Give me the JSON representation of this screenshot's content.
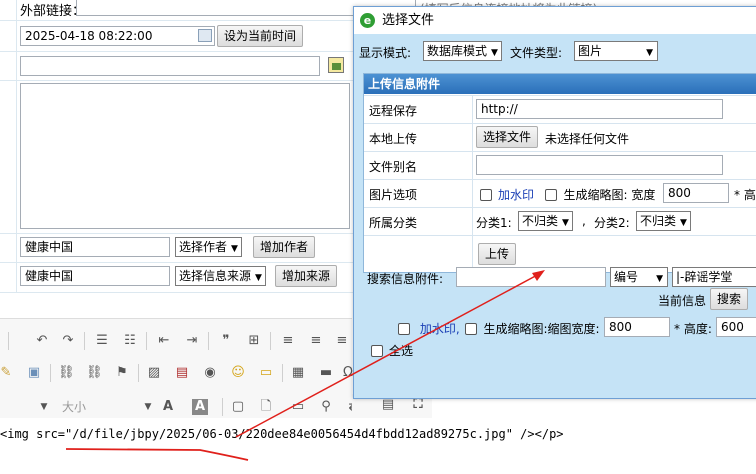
{
  "form": {
    "external_link_label": "外部链接：",
    "external_link_hint": "(填写后信息连接地址将为此链接)",
    "date_value": "2025-04-18 08:22:00",
    "set_time_button": "设为当前时间",
    "author_value": "健康中国",
    "author_select": "选择作者",
    "add_author_button": "增加作者",
    "source_value": "健康中国",
    "source_select": "选择信息来源",
    "add_source_button": "增加来源"
  },
  "editor": {
    "font_size_label": "大小",
    "source_code_line": "<img src=\"/d/file/jbpy/2025/06-03/220dee84e0056454d4fbdd12ad89275c.jpg\" /></p>"
  },
  "dialog": {
    "title": "选择文件",
    "display_mode_label": "显示模式:",
    "display_mode_value": "数据库模式",
    "file_type_label": "文件类型:",
    "file_type_value": "图片",
    "panel_title": "上传信息附件",
    "remote_save_label": "远程保存",
    "remote_url_value": "http://",
    "local_upload_label": "本地上传",
    "choose_file_button": "选择文件",
    "no_file_text": "未选择任何文件",
    "alias_label": "文件别名",
    "image_options_label": "图片选项",
    "watermark_label": "加水印",
    "thumbnail_label": "生成缩略图:",
    "width_label": "宽度",
    "width_value": "800",
    "height_label": "* 高",
    "category_label": "所属分类",
    "category1_label": "分类1:",
    "category1_value": "不归类",
    "category2_label": "分类2:",
    "category2_value": "不归类",
    "upload_button": "上传",
    "search_label": "搜索信息附件:",
    "search_field_select": "编号",
    "search_scope_select": "|-辟谣学堂",
    "current_info_label": "当前信息",
    "search_button": "搜索",
    "bottom_watermark_label": "加水印,",
    "bottom_thumbnail_label": "生成缩略图:缩图宽度:",
    "bottom_width_value": "800",
    "bottom_height_label": "* 高度:",
    "bottom_height_value": "600",
    "select_all_label": "全选"
  },
  "colors": {
    "dialog_background": "#c5e3f6",
    "panel_header": "#2a6fb9",
    "annotation_red": "#e0201b"
  }
}
